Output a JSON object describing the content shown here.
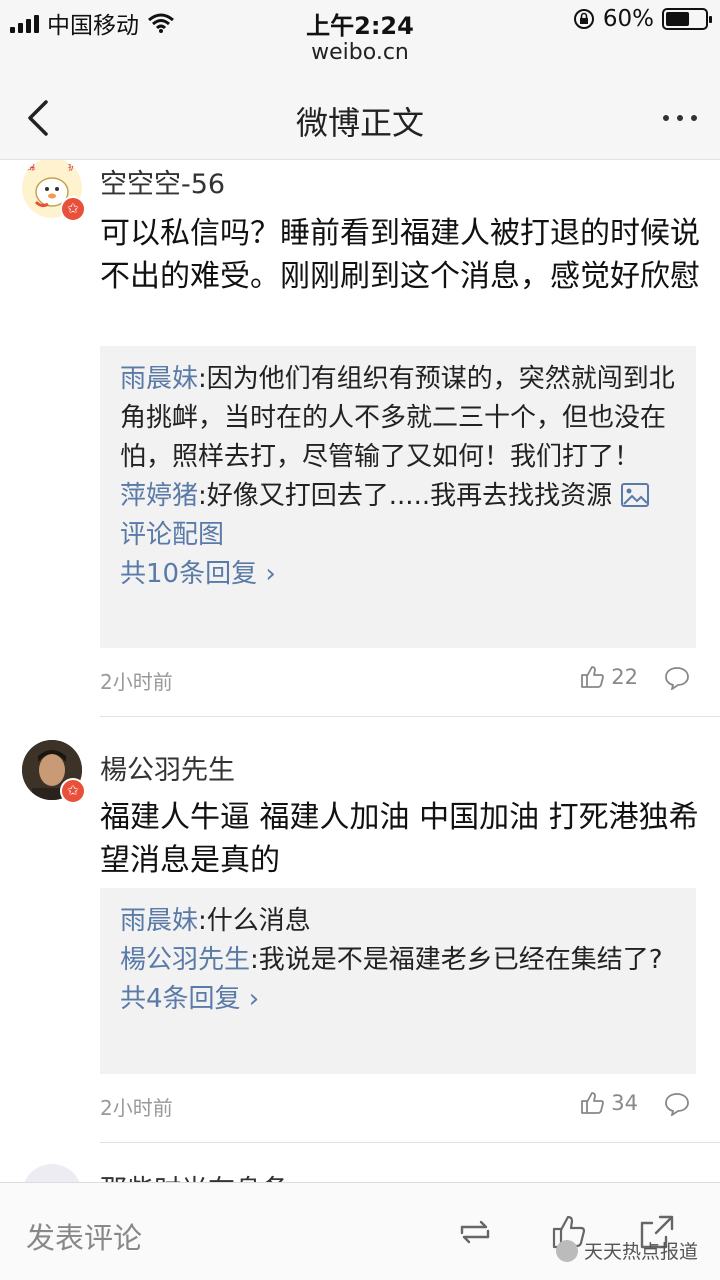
{
  "status_bar": {
    "carrier": "中国移动",
    "time": "上午2:24",
    "url": "weibo.cn",
    "battery": "60%",
    "battery_level": 0.6
  },
  "nav": {
    "title": "微博正文",
    "back_icon": "chevron-left-icon",
    "more_icon": "more-dots-icon"
  },
  "comments": [
    {
      "username": "空空空-56",
      "text": "可以私信吗？睡前看到福建人被打退的时候说不出的难受。刚刚刷到这个消息，感觉好欣慰",
      "replies": [
        {
          "name": "雨晨妹",
          "text": ":因为他们有组织有预谋的，突然就闯到北角挑衅，当时在的人不多就二三十个，但也没在怕，照样去打，尽管输了又如何！我们打了！"
        },
        {
          "name": "萍婷猪",
          "text": ":好像又打回去了.....我再去找找资源",
          "extra": "评论配图"
        }
      ],
      "more": "共10条回复",
      "time": "2小时前",
      "likes": "22"
    },
    {
      "username": "楊公羽先生",
      "text": "福建人牛逼 福建人加油 中国加油 打死港独希望消息是真的",
      "replies": [
        {
          "name": "雨晨妹",
          "text": ":什么消息"
        },
        {
          "name": "楊公羽先生",
          "text": ":我说是不是福建老乡已经在集结了?"
        }
      ],
      "more": "共4条回复",
      "time": "2小时前",
      "likes": "34"
    },
    {
      "username": "那些时光在身备"
    }
  ],
  "bottom_bar": {
    "input_placeholder": "发表评论",
    "watermark": "天天热点报道"
  }
}
